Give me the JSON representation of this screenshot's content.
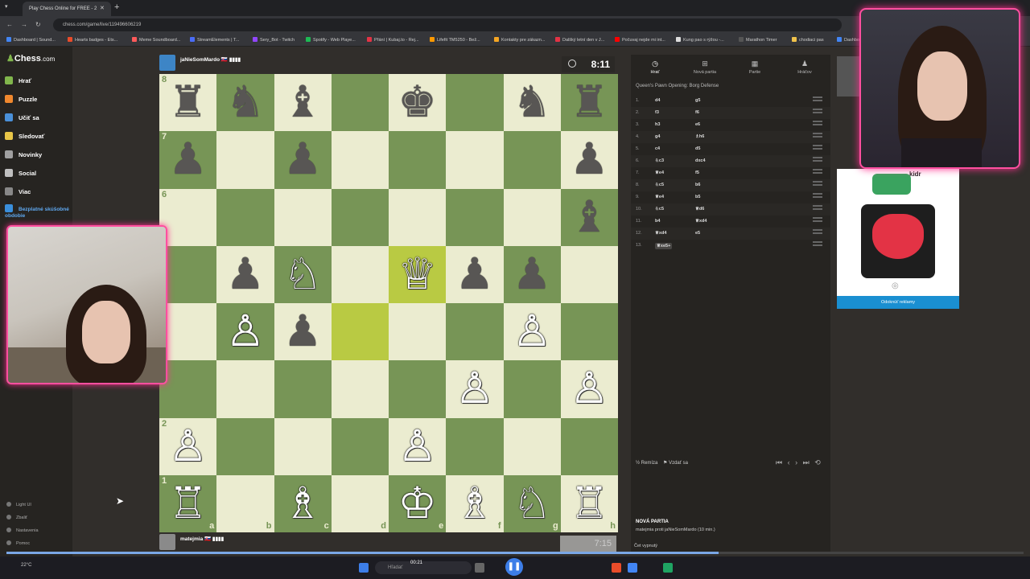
{
  "browser": {
    "tab_title": "Play Chess Online for FREE - 2",
    "url": "chess.com/game/live/119496606219",
    "bookmarks": [
      "Dashboard | Sound...",
      "Hearts badges - Ets...",
      "Meme Soundboard...",
      "StreamElements | T...",
      "Sery_Bot - Twitch",
      "Spotify - Web Playe...",
      "Přání | Kubaj.to - Rej...",
      "Lifefit TM5250 - Bež...",
      "Kontakty pre zákazn...",
      "Dalšký letní den v J...",
      "Počuvaj nejde mi int...",
      "Kung pao s rýžou -...",
      "Marathon Timer",
      "chodiaci pas",
      "Dashboa"
    ],
    "bookmark_colors": [
      "#4285f4",
      "#e94c2a",
      "#ff5a5a",
      "#4a6cf7",
      "#9146ff",
      "#1db954",
      "#e33345",
      "#ff9900",
      "#f5a623",
      "#e33345",
      "#ff0000",
      "#dddddd",
      "#555555",
      "#f0c24b",
      "#4285f4"
    ]
  },
  "sidebar": {
    "logo_a": "",
    "logo_b": "Chess",
    "logo_c": ".com",
    "items": [
      {
        "label": "Hrať",
        "color": "#81b64c"
      },
      {
        "label": "Puzzle",
        "color": "#f0882e"
      },
      {
        "label": "Učiť sa",
        "color": "#4a90d9"
      },
      {
        "label": "Sledovať",
        "color": "#e8c547"
      },
      {
        "label": "Novinky",
        "color": "#a0a0a0"
      },
      {
        "label": "Social",
        "color": "#c0c0c0"
      },
      {
        "label": "Viac",
        "color": "#888888"
      },
      {
        "label": "Bezplatné skúšobné obdobie",
        "color": "#3a8fdc"
      }
    ],
    "bottom": [
      "Light UI",
      "Zbaliť",
      "Nastavenia",
      "Pomoc"
    ]
  },
  "players": {
    "top": {
      "name": "jaNieSomMardo 🇸🇰 ▮▮▮▮",
      "clock": "8:11"
    },
    "bottom": {
      "name": "matejmia 🇸🇰 ▮▮▮▮",
      "clock": "7:15"
    }
  },
  "board": {
    "ranks": [
      "8",
      "7",
      "6",
      "5",
      "4",
      "3",
      "2",
      "1"
    ],
    "rank_labels_shown": [
      "8",
      "7",
      "6",
      "",
      "",
      "",
      "2",
      "1"
    ],
    "files": [
      "a",
      "b",
      "c",
      "d",
      "e",
      "f",
      "g",
      "h"
    ],
    "position": [
      [
        "♜",
        "♞",
        "♝",
        "",
        "♚",
        "",
        "♞",
        "♜"
      ],
      [
        "♟",
        "",
        "♟",
        "",
        "",
        "",
        "",
        "♟"
      ],
      [
        "",
        "",
        "",
        "",
        "",
        "",
        "",
        "♝"
      ],
      [
        "",
        "♟",
        "♘",
        "",
        "♕",
        "♟",
        "♟",
        ""
      ],
      [
        "",
        "♙",
        "♟",
        "",
        "",
        "",
        "♙",
        ""
      ],
      [
        "",
        "",
        "",
        "",
        "",
        "♙",
        "",
        "♙"
      ],
      [
        "♙",
        "",
        "",
        "",
        "♙",
        "",
        "",
        ""
      ],
      [
        "♖",
        "",
        "♗",
        "",
        "♔",
        "♗",
        "♘",
        "♖"
      ]
    ],
    "highlights": [
      "e5",
      "d4"
    ]
  },
  "panel": {
    "tabs": [
      {
        "icon": "◷",
        "label": "Hrať"
      },
      {
        "icon": "⊞",
        "label": "Nová partia"
      },
      {
        "icon": "▦",
        "label": "Partie"
      },
      {
        "icon": "♟",
        "label": "Hráčov"
      }
    ],
    "opening": "Queen's Pawn Opening: Borg Defense",
    "moves": [
      {
        "n": "1.",
        "w": "d4",
        "b": "g5"
      },
      {
        "n": "2.",
        "w": "f3",
        "b": "f6"
      },
      {
        "n": "3.",
        "w": "h3",
        "b": "e6"
      },
      {
        "n": "4.",
        "w": "g4",
        "b": "♗h6"
      },
      {
        "n": "5.",
        "w": "c4",
        "b": "d5"
      },
      {
        "n": "6.",
        "w": "♘c3",
        "b": "dxc4"
      },
      {
        "n": "7.",
        "w": "♕e4",
        "b": "f5"
      },
      {
        "n": "8.",
        "w": "♘c5",
        "b": "b6"
      },
      {
        "n": "9.",
        "w": "♕e4",
        "b": "b5"
      },
      {
        "n": "10.",
        "w": "♘c5",
        "b": "♕d6"
      },
      {
        "n": "11.",
        "w": "b4",
        "b": "♕xd4"
      },
      {
        "n": "12.",
        "w": "♕xd4",
        "b": "e5"
      },
      {
        "n": "13.",
        "w": "♕xe5+",
        "b": ""
      }
    ],
    "draw": "Remíza",
    "resign": "Vzdať sa",
    "nav": "⏮ ‹ › ⏭ ⟲",
    "new_game_title": "NOVÁ PARTIA",
    "new_game_sub": "matejmia proti jaNieSomMardo (10 min.)",
    "chat": "Čet vypnutý"
  },
  "ad": {
    "brand": "kidr",
    "button": "Odoknúť reklamy"
  },
  "taskbar": {
    "search": "Hľadať",
    "time": "00:21",
    "weather": "22°C",
    "progress_fraction": 0.7
  }
}
